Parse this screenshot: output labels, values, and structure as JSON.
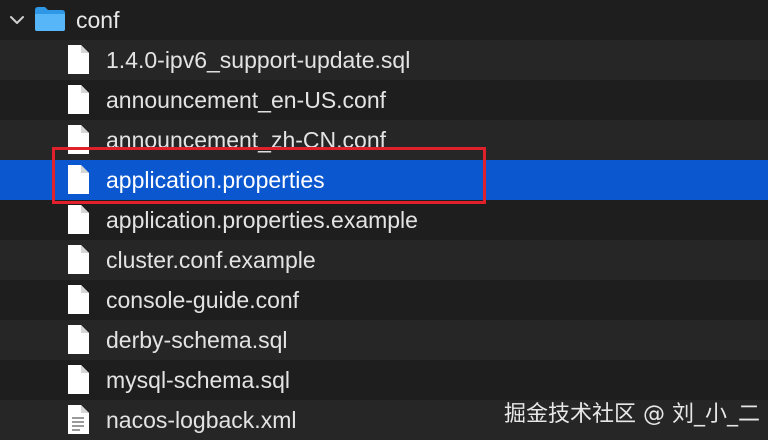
{
  "folder": {
    "name": "conf",
    "expanded": true,
    "icon": "folder-icon",
    "color": "#3fa9f5"
  },
  "files": [
    {
      "name": "1.4.0-ipv6_support-update.sql",
      "icon": "document-icon"
    },
    {
      "name": "announcement_en-US.conf",
      "icon": "document-icon"
    },
    {
      "name": "announcement_zh-CN.conf",
      "icon": "document-icon"
    },
    {
      "name": "application.properties",
      "icon": "document-icon",
      "selected": true,
      "highlighted": true
    },
    {
      "name": "application.properties.example",
      "icon": "document-icon"
    },
    {
      "name": "cluster.conf.example",
      "icon": "document-icon"
    },
    {
      "name": "console-guide.conf",
      "icon": "document-icon"
    },
    {
      "name": "derby-schema.sql",
      "icon": "document-icon"
    },
    {
      "name": "mysql-schema.sql",
      "icon": "document-icon"
    },
    {
      "name": "nacos-logback.xml",
      "icon": "xml-document-icon"
    }
  ],
  "colors": {
    "selection": "#0a57d0",
    "highlight_border": "#e0202a"
  },
  "watermark": "掘金技术社区 @ 刘_小_二"
}
